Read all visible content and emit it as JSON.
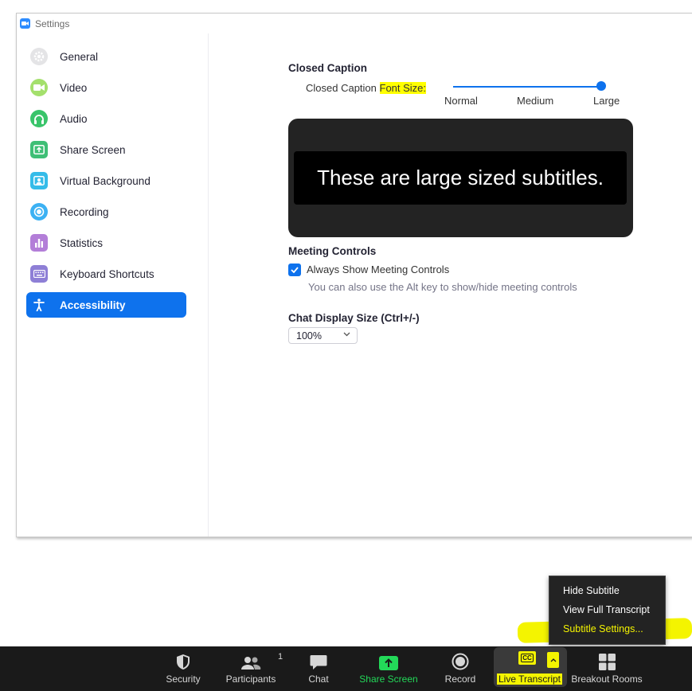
{
  "window": {
    "title": "Settings"
  },
  "sidebar": {
    "items": [
      {
        "label": "General",
        "icon": "gear-icon",
        "color": "#e4e4e6"
      },
      {
        "label": "Video",
        "icon": "video-icon",
        "color": "#a4e06c"
      },
      {
        "label": "Audio",
        "icon": "headphones-icon",
        "color": "#39c46a"
      },
      {
        "label": "Share Screen",
        "icon": "share-screen-icon",
        "color": "#3fbf76"
      },
      {
        "label": "Virtual Background",
        "icon": "person-icon",
        "color": "#35bce9"
      },
      {
        "label": "Recording",
        "icon": "record-icon",
        "color": "#3cb1f3"
      },
      {
        "label": "Statistics",
        "icon": "bar-chart-icon",
        "color": "#b37ed8"
      },
      {
        "label": "Keyboard Shortcuts",
        "icon": "keyboard-icon",
        "color": "#8e7fd6"
      },
      {
        "label": "Accessibility",
        "icon": "accessibility-icon",
        "active": true
      }
    ]
  },
  "closed_caption": {
    "heading": "Closed Caption",
    "label_part1": "Closed Caption ",
    "label_part2": "Font Size:",
    "ticks": [
      "Normal",
      "Medium",
      "Large"
    ],
    "selected": "Large",
    "preview_text": "These are large sized subtitles."
  },
  "meeting_controls": {
    "heading": "Meeting Controls",
    "checkbox_label": "Always Show Meeting Controls",
    "checked": true,
    "hint": "You can also use the Alt key to show/hide meeting controls"
  },
  "chat_display": {
    "heading": "Chat Display Size (Ctrl+/-)",
    "value": "100%"
  },
  "toolbar": {
    "items": [
      {
        "label": "Security",
        "icon": "shield-icon"
      },
      {
        "label": "Participants",
        "icon": "participants-icon",
        "count": "1"
      },
      {
        "label": "Chat",
        "icon": "chat-bubble-icon"
      },
      {
        "label": "Share Screen",
        "icon": "share-screen-icon",
        "color": "#23d959"
      },
      {
        "label": "Record",
        "icon": "record-icon"
      },
      {
        "label": "Live Transcript",
        "icon": "cc-icon",
        "cc_text": "CC"
      },
      {
        "label": "Breakout Rooms",
        "icon": "breakout-rooms-icon"
      }
    ]
  },
  "menu": {
    "items": [
      "Hide Subtitle",
      "View Full Transcript",
      "Subtitle Settings..."
    ]
  },
  "colors": {
    "accent": "#0e72ed",
    "highlight": "#ffff00",
    "toolbar_bg": "#1a1a1a"
  }
}
